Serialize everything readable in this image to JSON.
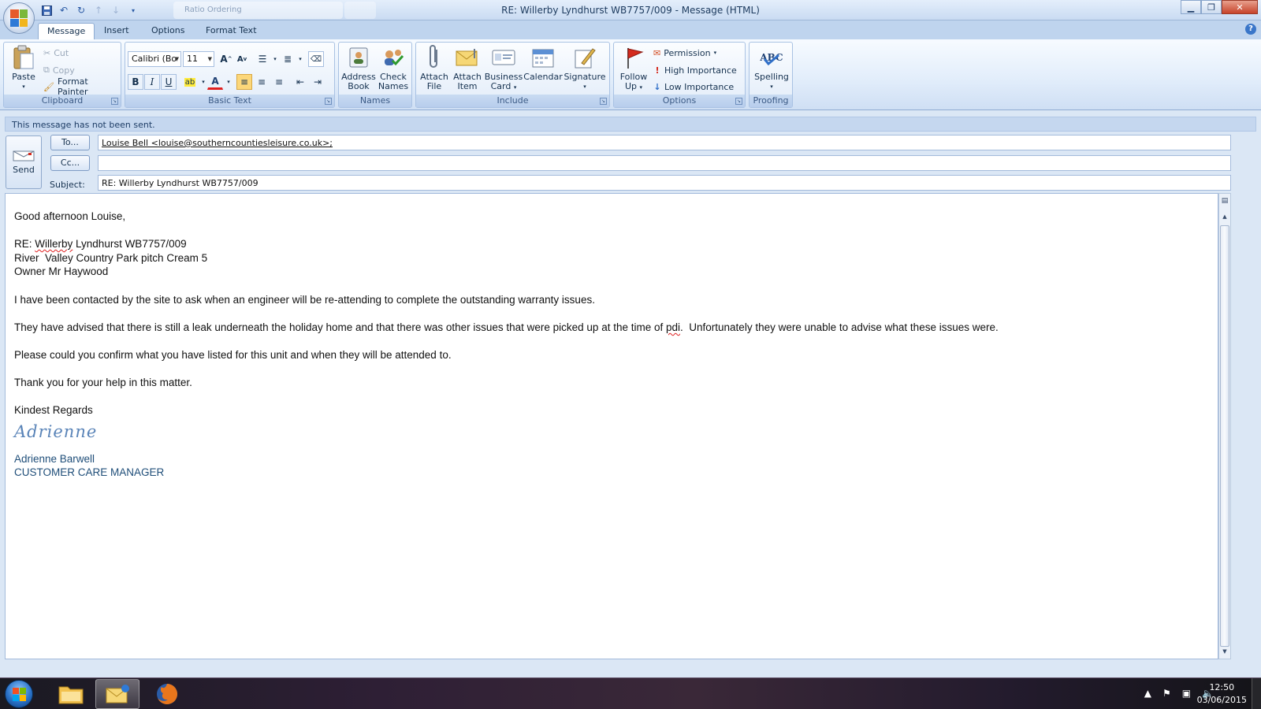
{
  "window": {
    "title": "RE: Willerby Lyndhurst WB7757/009 - Message (HTML)",
    "background_tab": "Ratio Ordering"
  },
  "tabs": [
    {
      "label": "Message",
      "active": true
    },
    {
      "label": "Insert"
    },
    {
      "label": "Options"
    },
    {
      "label": "Format Text"
    }
  ],
  "clipboard": {
    "paste": "Paste",
    "cut": "Cut",
    "copy": "Copy",
    "format_painter": "Format Painter",
    "label": "Clipboard"
  },
  "basic_text": {
    "font": "Calibri (Bo",
    "size": "11",
    "label": "Basic Text"
  },
  "names": {
    "address_book_1": "Address",
    "address_book_2": "Book",
    "check_names_1": "Check",
    "check_names_2": "Names",
    "label": "Names"
  },
  "include": {
    "attach_file_1": "Attach",
    "attach_file_2": "File",
    "attach_item_1": "Attach",
    "attach_item_2": "Item",
    "business_card_1": "Business",
    "business_card_2": "Card",
    "calendar": "Calendar",
    "signature": "Signature",
    "label": "Include"
  },
  "options": {
    "follow_up_1": "Follow",
    "follow_up_2": "Up",
    "permission": "Permission",
    "high_importance": "High Importance",
    "low_importance": "Low Importance",
    "label": "Options"
  },
  "proofing": {
    "spelling_icon": "ABC",
    "spelling": "Spelling",
    "label": "Proofing"
  },
  "infobar": "This message has not been sent.",
  "compose": {
    "send": "Send",
    "to_button": "To...",
    "cc_button": "Cc...",
    "subject_label": "Subject:",
    "to_value": "Louise Bell <louise@southerncountiesleisure.co.uk>;",
    "cc_value": "",
    "subject_value": "RE: Willerby Lyndhurst WB7757/009"
  },
  "body": {
    "greeting": "Good afternoon Louise,",
    "re_prefix": "RE: ",
    "re_word": "Willerby",
    "re_rest": " Lyndhurst WB7757/009",
    "line_park": "River  Valley Country Park pitch Cream 5",
    "line_owner": "Owner Mr Haywood",
    "para1": "I have been contacted by the site to ask when an engineer will be re-attending to complete the outstanding warranty issues.",
    "para2_a": "They have advised that there is still a leak underneath the holiday home and that there was other issues that were picked up at the time of ",
    "para2_word": "pdi",
    "para2_b": ".  Unfortunately they were unable to advise what these issues were.",
    "para3": "Please could you confirm what you have listed for this unit and when they will be attended to.",
    "para4": "Thank you for your help in this matter.",
    "closing": "Kindest Regards",
    "signature": "Adrienne",
    "sig_name": "Adrienne Barwell",
    "sig_title": "CUSTOMER CARE MANAGER"
  },
  "taskbar": {
    "time": "12:50",
    "date": "03/06/2015"
  }
}
